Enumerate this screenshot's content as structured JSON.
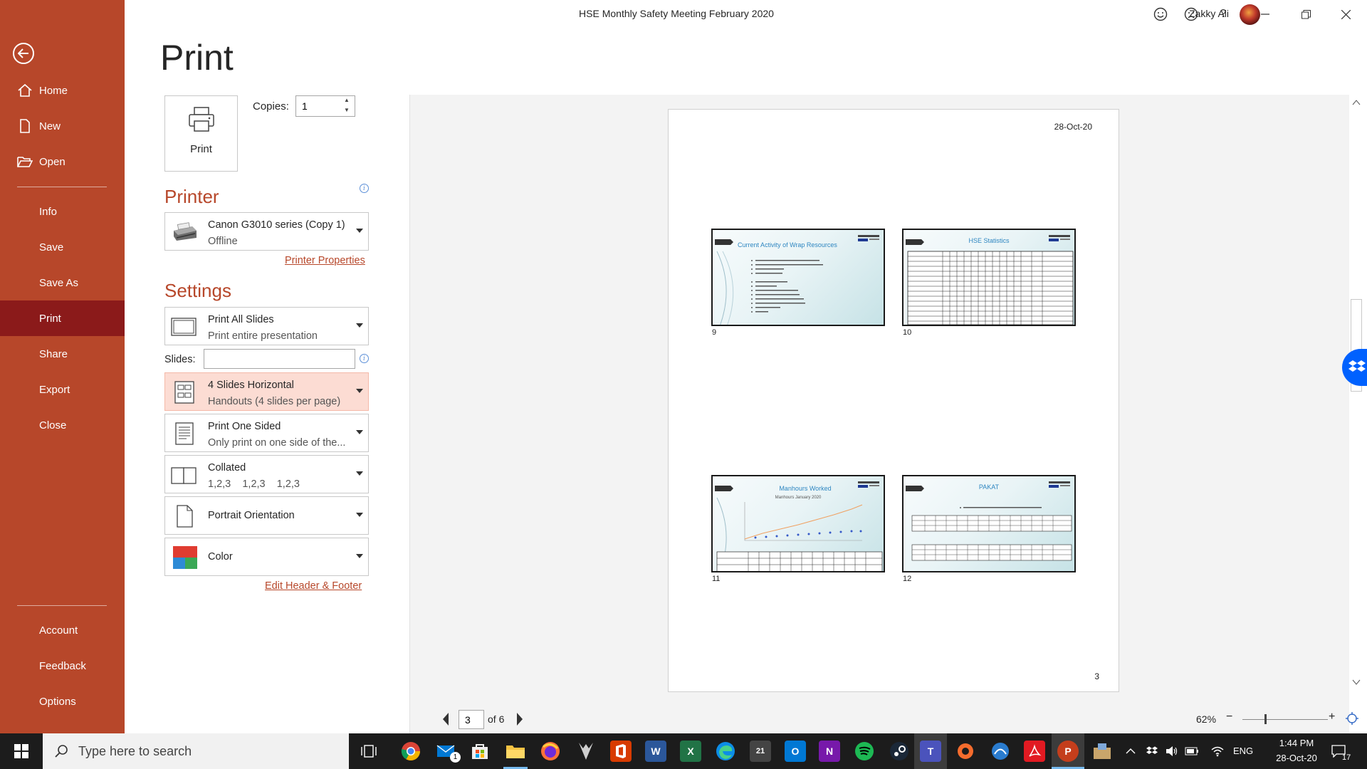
{
  "window": {
    "title": "HSE Monthly Safety Meeting February 2020",
    "user_name": "Zakky Ali",
    "help": "?"
  },
  "nav": {
    "items": [
      {
        "label": "Home",
        "icon": "home-icon"
      },
      {
        "label": "New",
        "icon": "new-doc-icon"
      },
      {
        "label": "Open",
        "icon": "folder-open-icon"
      },
      {
        "label": "Info"
      },
      {
        "label": "Save"
      },
      {
        "label": "Save As"
      },
      {
        "label": "Print"
      },
      {
        "label": "Share"
      },
      {
        "label": "Export"
      },
      {
        "label": "Close"
      }
    ],
    "bottom_items": [
      {
        "label": "Account"
      },
      {
        "label": "Feedback"
      },
      {
        "label": "Options"
      }
    ],
    "active": "Print"
  },
  "print": {
    "heading": "Print",
    "button_label": "Print",
    "copies_label": "Copies:",
    "copies_value": "1"
  },
  "printer": {
    "heading": "Printer",
    "name": "Canon G3010 series (Copy 1)",
    "status": "Offline",
    "properties_link": "Printer Properties"
  },
  "settings": {
    "heading": "Settings",
    "print_range": {
      "title": "Print All Slides",
      "subtitle": "Print entire presentation"
    },
    "slides_label": "Slides:",
    "slides_value": "",
    "layout": {
      "title": "4 Slides Horizontal",
      "subtitle": "Handouts (4 slides per page)"
    },
    "sides": {
      "title": "Print One Sided",
      "subtitle": "Only print on one side of the..."
    },
    "collation": {
      "title": "Collated",
      "subtitle": "1,2,3    1,2,3    1,2,3"
    },
    "orientation": {
      "title": "Portrait Orientation"
    },
    "color": {
      "title": "Color"
    },
    "header_footer_link": "Edit Header & Footer"
  },
  "preview": {
    "date": "28-Oct-20",
    "page_number": "3",
    "slides": [
      {
        "number": "9",
        "title": "Current Activity of Wrap Resources"
      },
      {
        "number": "10",
        "title": "HSE Statistics"
      },
      {
        "number": "11",
        "title": "Manhours Worked",
        "subtitle": "Manhours January 2020"
      },
      {
        "number": "12",
        "title": "PAKAT"
      }
    ]
  },
  "pager": {
    "current": "3",
    "of_label": "of 6",
    "zoom": "62%"
  },
  "taskbar": {
    "search_placeholder": "Type here to search",
    "mail_badge": "1",
    "calendar_number": "21",
    "language": "ENG",
    "time": "1:44 PM",
    "date": "28-Oct-20",
    "notifications_count": "17"
  },
  "colors": {
    "accent": "#b7472a",
    "nav_active": "#8b1a1a",
    "highlight": "#fcdcd3",
    "taskbar": "#1c1c1c"
  }
}
